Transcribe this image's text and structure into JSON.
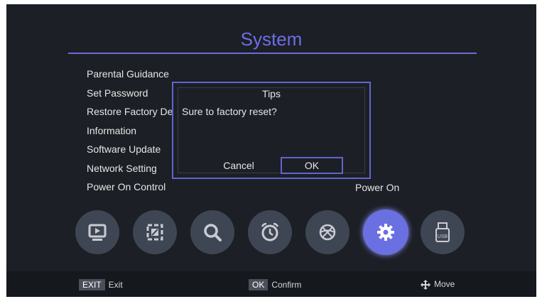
{
  "title": "System",
  "menu": [
    "Parental Guidance",
    "Set Password",
    "Restore Factory Default",
    "Information",
    "Software Update",
    "Network Setting",
    "Power On Control"
  ],
  "power_on_value": "Power On",
  "dialog": {
    "title": "Tips",
    "message": "Sure to factory reset?",
    "cancel_label": "Cancel",
    "ok_label": "OK"
  },
  "icons": [
    {
      "name": "tv",
      "active": false
    },
    {
      "name": "picture",
      "active": false
    },
    {
      "name": "search",
      "active": false
    },
    {
      "name": "alarm-clock",
      "active": false
    },
    {
      "name": "ball",
      "active": false
    },
    {
      "name": "gear",
      "active": true
    },
    {
      "name": "usb",
      "active": false
    }
  ],
  "footer": {
    "exit_key": "EXIT",
    "exit_label": "Exit",
    "ok_key": "OK",
    "ok_label": "Confirm",
    "move_label": "Move"
  },
  "colors": {
    "accent": "#6264d0",
    "title": "#6d6ee6",
    "background": "#1c1f25"
  }
}
